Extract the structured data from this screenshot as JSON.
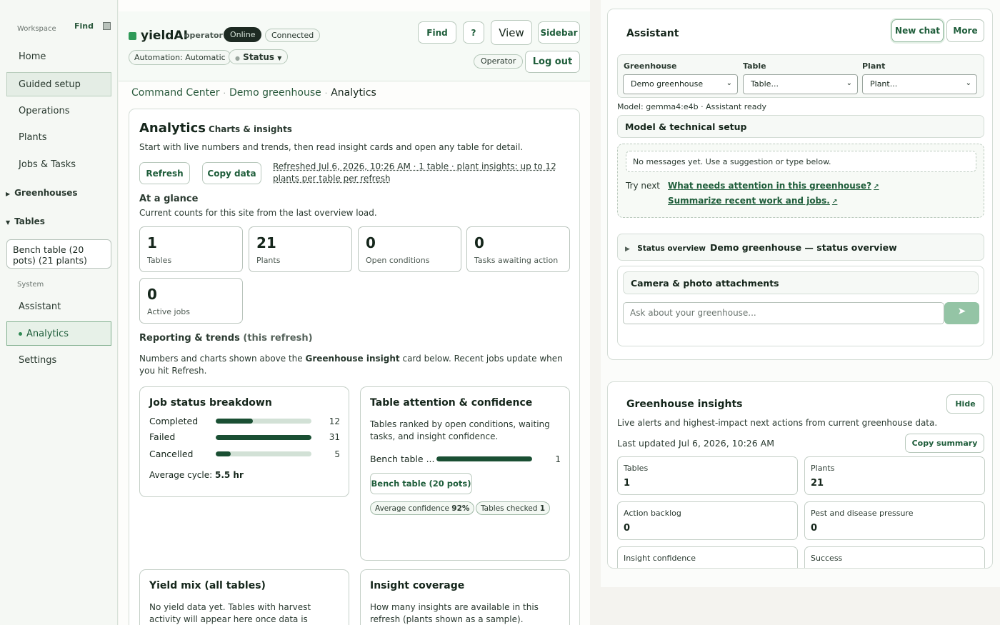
{
  "sidebar": {
    "workspace_label": "Workspace",
    "find_label": "Find",
    "items": [
      "Home",
      "Guided setup",
      "Operations",
      "Plants",
      "Jobs & Tasks"
    ],
    "greenhouses_label": "Greenhouses",
    "tables_label": "Tables",
    "table_card": "Bench table (20 pots) (21 plants)",
    "system_label": "System",
    "system_items": [
      "Assistant",
      "Analytics",
      "Settings"
    ]
  },
  "topbar": {
    "brand": "yieldAI",
    "role": "operator",
    "online": "Online",
    "connected": "Connected",
    "automation": "Automation: Automatic",
    "status": "Status",
    "find": "Find",
    "help": "?",
    "view": "View",
    "sidebar": "Sidebar",
    "operator": "Operator",
    "logout": "Log out"
  },
  "breadcrumb": [
    "Command Center",
    "Demo greenhouse",
    "Analytics"
  ],
  "analytics": {
    "title": "Analytics",
    "subtitle": "Charts & insights",
    "description": "Start with live numbers and trends, then read insight cards and open any table for detail.",
    "refresh_btn": "Refresh",
    "copy_btn": "Copy data",
    "refresh_note": "Refreshed Jul 6, 2026, 10:26 AM · 1 table · plant insights: up to 12 plants per table per refresh",
    "glance_title": "At a glance",
    "glance_sub": "Current counts for this site from the last overview load.",
    "stats": [
      {
        "num": "1",
        "label": "Tables"
      },
      {
        "num": "21",
        "label": "Plants"
      },
      {
        "num": "0",
        "label": "Open conditions"
      },
      {
        "num": "0",
        "label": "Tasks awaiting action"
      },
      {
        "num": "0",
        "label": "Active jobs"
      }
    ],
    "reporting_title": "Reporting & trends",
    "reporting_paren": "(this refresh)",
    "reporting_desc_a": "Numbers and charts shown above the ",
    "reporting_desc_b": "Greenhouse insight",
    "reporting_desc_c": " card below. Recent jobs update when you hit Refresh.",
    "job_card": {
      "title": "Job status breakdown",
      "rows": [
        {
          "label": "Completed",
          "value": "12",
          "fraction": 0.39
        },
        {
          "label": "Failed",
          "value": "31",
          "fraction": 1.0
        },
        {
          "label": "Cancelled",
          "value": "5",
          "fraction": 0.16
        }
      ],
      "avg_label": "Average cycle: ",
      "avg_value": "5.5 hr"
    },
    "attention_card": {
      "title": "Table attention & confidence",
      "desc": "Tables ranked by open conditions, waiting tasks, and insight confidence.",
      "row_label": "Bench table ...",
      "row_value": "1",
      "row_fraction": 1.0,
      "btn": "Bench table (20 pots)",
      "chip1_label": "Average confidence ",
      "chip1_value": "92%",
      "chip2_label": "Tables checked ",
      "chip2_value": "1"
    },
    "yield_card": {
      "title": "Yield mix (all tables)",
      "desc": "No yield data yet. Tables with harvest activity will appear here once data is available."
    },
    "coverage_card": {
      "title": "Insight coverage",
      "desc": "How many insights are available in this refresh (plants shown as a sample)."
    }
  },
  "assistant": {
    "title": "Assistant",
    "new_chat": "New chat",
    "more": "More",
    "greenhouse_label": "Greenhouse",
    "greenhouse_value": "Demo greenhouse",
    "table_label": "Table",
    "table_value": "Table...",
    "plant_label": "Plant",
    "plant_value": "Plant...",
    "model_line": "Model: gemma4:e4b · Assistant ready",
    "model_setup": "Model & technical setup",
    "no_messages": "No messages yet. Use a suggestion or type below.",
    "try_next": "Try next",
    "suggestions": [
      "What needs attention in this greenhouse?",
      "Summarize recent work and jobs."
    ],
    "status_label": "Status overview",
    "status_value": "Demo greenhouse — status overview",
    "camera": "Camera & photo attachments",
    "input_placeholder": "Ask about your greenhouse..."
  },
  "insights": {
    "title": "Greenhouse insights",
    "hide": "Hide",
    "desc": "Live alerts and highest-impact next actions from current greenhouse data.",
    "updated": "Last updated Jul 6, 2026, 10:26 AM",
    "copy_summary": "Copy summary",
    "stats": [
      {
        "label": "Tables",
        "value": "1"
      },
      {
        "label": "Plants",
        "value": "21"
      },
      {
        "label": "Action backlog",
        "value": "0"
      },
      {
        "label": "Pest and disease pressure",
        "value": "0"
      },
      {
        "label": "Insight confidence",
        "value": ""
      },
      {
        "label": "Success",
        "value": ""
      }
    ]
  },
  "colors": {
    "accent": "#1e5d3a",
    "bar": "#1a4f33",
    "online": "#2f9a58"
  }
}
